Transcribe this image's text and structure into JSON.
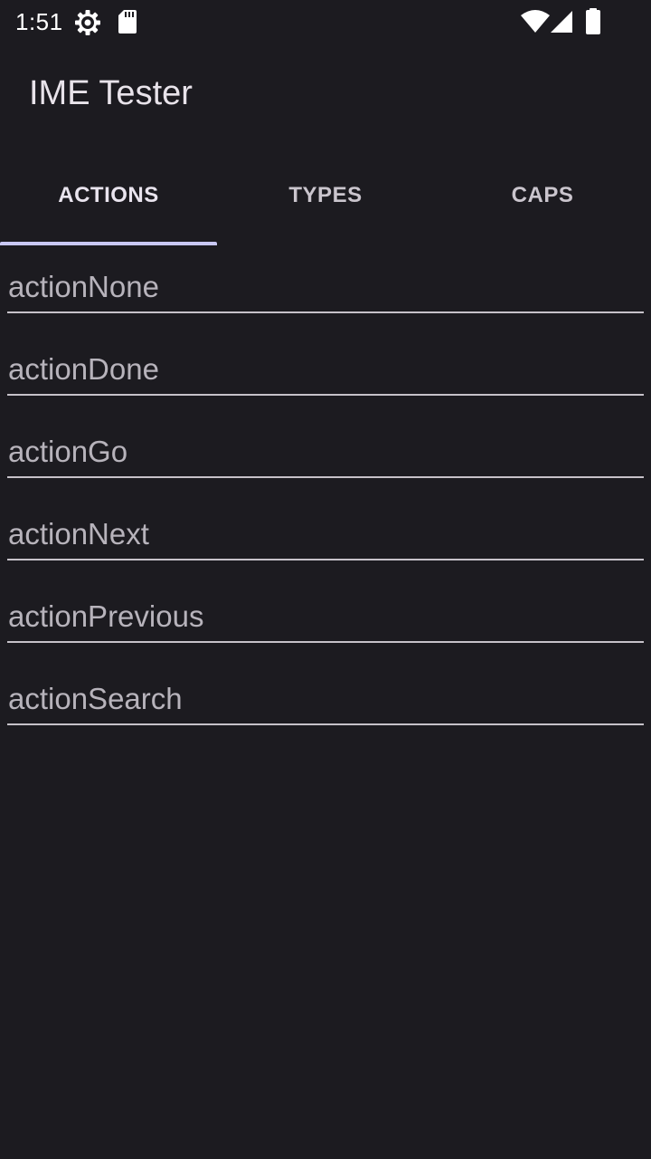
{
  "status_bar": {
    "time": "1:51",
    "icons": [
      "settings-gear-icon",
      "sd-card-icon",
      "wifi-icon",
      "cell-signal-icon",
      "battery-icon"
    ]
  },
  "app_bar": {
    "title": "IME Tester"
  },
  "tabs": [
    {
      "label": "ACTIONS",
      "selected": true
    },
    {
      "label": "TYPES",
      "selected": false
    },
    {
      "label": "CAPS",
      "selected": false
    }
  ],
  "fields": [
    {
      "placeholder": "actionNone"
    },
    {
      "placeholder": "actionDone"
    },
    {
      "placeholder": "actionGo"
    },
    {
      "placeholder": "actionNext"
    },
    {
      "placeholder": "actionPrevious"
    },
    {
      "placeholder": "actionSearch"
    }
  ],
  "colors": {
    "background": "#1c1b20",
    "tab_indicator": "#c9c8f5",
    "underline": "#c6c2c9"
  }
}
